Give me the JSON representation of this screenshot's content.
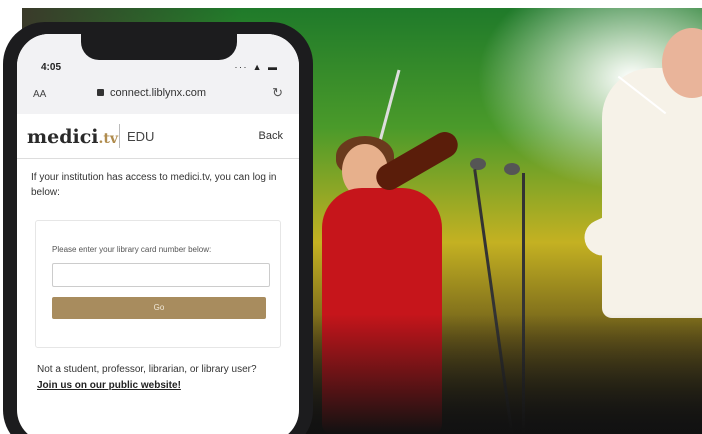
{
  "status": {
    "time": "4:05",
    "icons": "∙∙∙ ▲ ▬"
  },
  "browser": {
    "text_size": "AA",
    "url": "connect.liblynx.com",
    "reload_icon": "reload-icon"
  },
  "header": {
    "brand": "medici",
    "brand_tld": ".tv",
    "section": "EDU",
    "back_label": "Back"
  },
  "intro": {
    "text": "If your institution has access to medici.tv, you can log in below:"
  },
  "login": {
    "label": "Please enter your library card number below:",
    "card_input_value": "",
    "go_label": "Go"
  },
  "footer": {
    "question": "Not a student, professor, librarian, or library user?",
    "link": "Join us on our public website!"
  },
  "colors": {
    "accent": "#a88c5e",
    "dress": "#c6151b",
    "jacket": "#f6f2e8"
  }
}
